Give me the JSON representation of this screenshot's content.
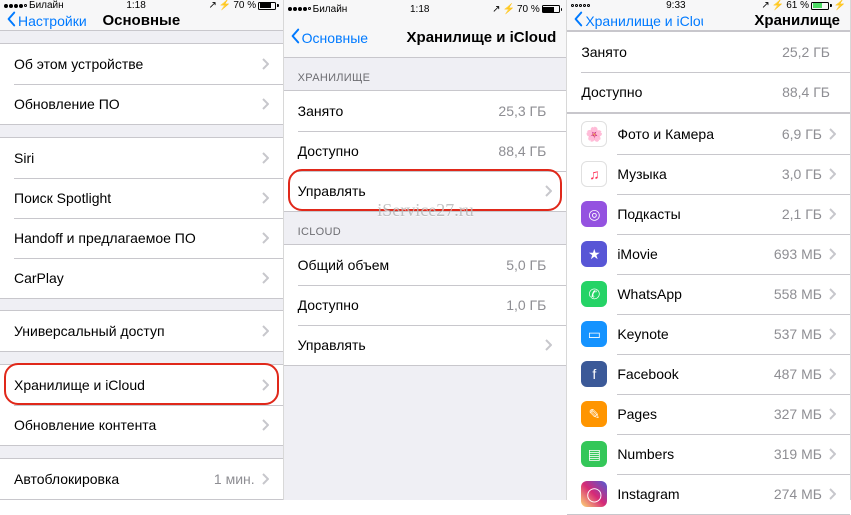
{
  "watermark": "iService27.ru",
  "s1": {
    "status": {
      "carrier": "Билайн",
      "time": "1:18",
      "pct": "70 %",
      "batt_fill": "70%"
    },
    "back": "Настройки",
    "title": "Основные",
    "g1": [
      "Об этом устройстве",
      "Обновление ПО"
    ],
    "g2": [
      "Siri",
      "Поиск Spotlight",
      "Handoff и предлагаемое ПО",
      "CarPlay"
    ],
    "g3": [
      "Универсальный доступ"
    ],
    "g4": [
      "Хранилище и iCloud",
      "Обновление контента"
    ],
    "g5_label": "Автоблокировка",
    "g5_value": "1 мин."
  },
  "s2": {
    "status": {
      "carrier": "Билайн",
      "time": "1:18",
      "pct": "70 %",
      "batt_fill": "70%"
    },
    "back": "Основные",
    "title": "Хранилище и iCloud",
    "sec1": "ХРАНИЛИЩЕ",
    "storage": [
      {
        "l": "Занято",
        "v": "25,3 ГБ"
      },
      {
        "l": "Доступно",
        "v": "88,4 ГБ"
      },
      {
        "l": "Управлять",
        "v": ""
      }
    ],
    "sec2": "ICLOUD",
    "icloud": [
      {
        "l": "Общий объем",
        "v": "5,0 ГБ"
      },
      {
        "l": "Доступно",
        "v": "1,0 ГБ"
      },
      {
        "l": "Управлять",
        "v": ""
      }
    ]
  },
  "s3": {
    "status": {
      "carrier": "",
      "time": "9:33",
      "pct": "61 %",
      "batt_fill": "61%"
    },
    "back": "Хранилище и iCloud",
    "title": "Хранилище",
    "top": [
      {
        "l": "Занято",
        "v": "25,2 ГБ"
      },
      {
        "l": "Доступно",
        "v": "88,4 ГБ"
      }
    ],
    "apps": [
      {
        "l": "Фото и Камера",
        "v": "6,9 ГБ",
        "bg": "#fff",
        "glyph": "🌸"
      },
      {
        "l": "Музыка",
        "v": "3,0 ГБ",
        "bg": "#ffffff",
        "glyph": "♫",
        "fg": "#ff2d55"
      },
      {
        "l": "Подкасты",
        "v": "2,1 ГБ",
        "bg": "#9452e0",
        "glyph": "◎"
      },
      {
        "l": "iMovie",
        "v": "693 МБ",
        "bg": "#5856d6",
        "glyph": "★"
      },
      {
        "l": "WhatsApp",
        "v": "558 МБ",
        "bg": "#25d366",
        "glyph": "✆"
      },
      {
        "l": "Keynote",
        "v": "537 МБ",
        "bg": "#1593ff",
        "glyph": "▭"
      },
      {
        "l": "Facebook",
        "v": "487 МБ",
        "bg": "#3b5998",
        "glyph": "f"
      },
      {
        "l": "Pages",
        "v": "327 МБ",
        "bg": "#ff9500",
        "glyph": "✎"
      },
      {
        "l": "Numbers",
        "v": "319 МБ",
        "bg": "#34c759",
        "glyph": "▤"
      },
      {
        "l": "Instagram",
        "v": "274 МБ",
        "bg": "linear-gradient(45deg,#feda75,#d62976,#4f5bd5)",
        "glyph": "◯"
      }
    ]
  }
}
